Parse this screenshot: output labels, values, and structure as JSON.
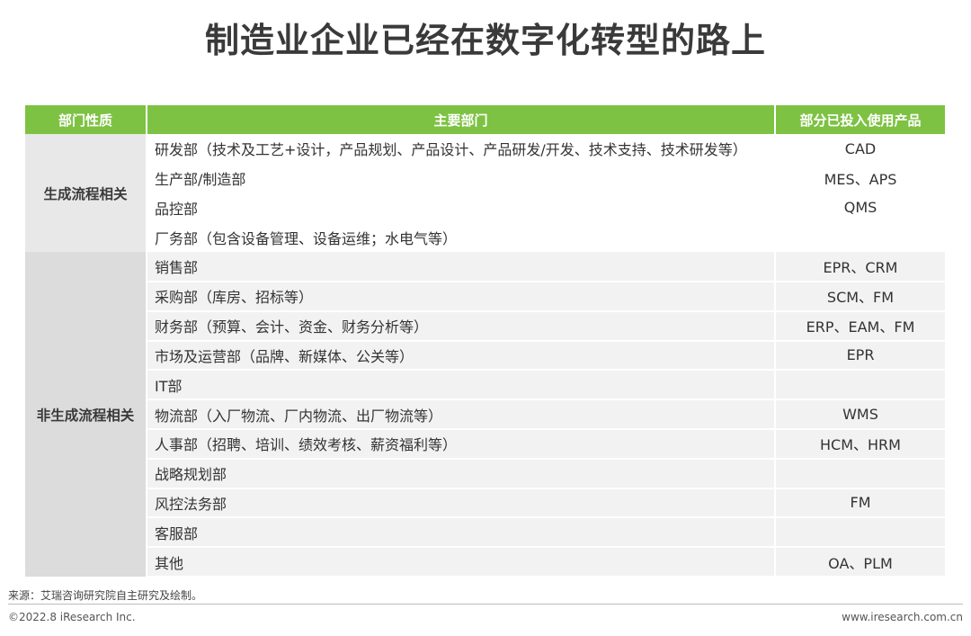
{
  "title": "制造业企业已经在数字化转型的路上",
  "table": {
    "headers": [
      "部门性质",
      "主要部门",
      "部分已投入使用产品"
    ],
    "groups": [
      {
        "category": "生成流程相关",
        "rows": [
          {
            "dept": "研发部（技术及工艺+设计，产品规划、产品设计、产品研发/开发、技术支持、技术研发等）",
            "products": "CAD"
          },
          {
            "dept": "生产部/制造部",
            "products": "MES、APS"
          },
          {
            "dept": "品控部",
            "products": "QMS"
          },
          {
            "dept": "厂务部（包含设备管理、设备运维；水电气等）",
            "products": ""
          }
        ]
      },
      {
        "category": "非生成流程相关",
        "rows": [
          {
            "dept": "销售部",
            "products": "EPR、CRM"
          },
          {
            "dept": "采购部（库房、招标等）",
            "products": "SCM、FM"
          },
          {
            "dept": "财务部（预算、会计、资金、财务分析等）",
            "products": "ERP、EAM、FM"
          },
          {
            "dept": "市场及运营部（品牌、新媒体、公关等）",
            "products": "EPR"
          },
          {
            "dept": "IT部",
            "products": ""
          },
          {
            "dept": "物流部（入厂物流、厂内物流、出厂物流等）",
            "products": "WMS"
          },
          {
            "dept": "人事部（招聘、培训、绩效考核、薪资福利等）",
            "products": "HCM、HRM"
          },
          {
            "dept": "战略规划部",
            "products": ""
          },
          {
            "dept": "风控法务部",
            "products": "FM"
          },
          {
            "dept": "客服部",
            "products": ""
          },
          {
            "dept": "其他",
            "products": "OA、PLM"
          }
        ]
      }
    ]
  },
  "footer": {
    "source": "来源：艾瑞咨询研究院自主研究及绘制。",
    "copyright": "©2022.8 iResearch Inc.",
    "website": "www.iresearch.com.cn"
  },
  "colors": {
    "header_green": "#7dc242",
    "category_gray": "#e8e8e8",
    "row_stripe": "#f2f2f2"
  }
}
